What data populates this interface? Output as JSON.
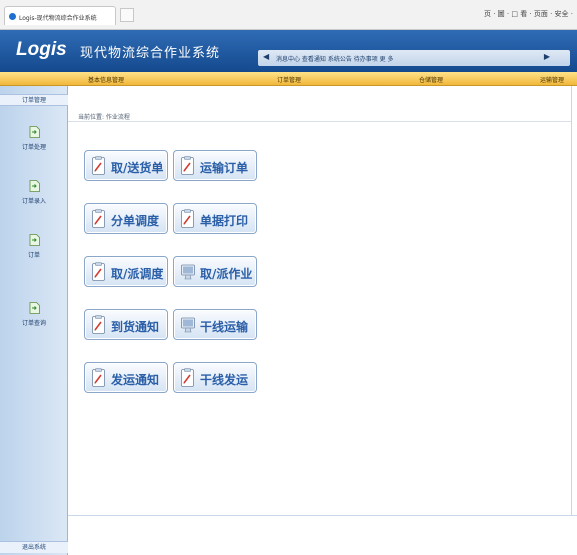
{
  "browser": {
    "tab_title": "Logis-现代物流综合作业系统",
    "toolbar_text": "页 · 圖 · □ 看 · 页面 · 安全 ·"
  },
  "header": {
    "logo": "Logis",
    "system_name": "现代物流综合作业系统",
    "ticker_text": "消息中心 查看通知 系统公告 待办事项 更 多"
  },
  "menu": {
    "items": [
      "基本信息管理",
      "订单管理",
      "仓储管理",
      "运输管理"
    ]
  },
  "sidebar": {
    "header": "订单管理",
    "items": [
      {
        "label": "订单处理",
        "icon": "document-arrow-icon"
      },
      {
        "label": "订单录入",
        "icon": "document-arrow-icon"
      },
      {
        "label": "订单",
        "icon": "document-arrow-icon"
      },
      {
        "label": "订单查询",
        "icon": "document-arrow-icon"
      }
    ],
    "footer": "退出系统"
  },
  "breadcrumb": "当前位置: 作业流程",
  "functions": [
    {
      "label": "取/送货单",
      "icon": "document-pen-icon"
    },
    {
      "label": "运输订单",
      "icon": "document-pen-icon"
    },
    {
      "label": "分单调度",
      "icon": "document-pen-icon"
    },
    {
      "label": "单据打印",
      "icon": "document-pen-icon"
    },
    {
      "label": "取/派调度",
      "icon": "document-pen-icon"
    },
    {
      "label": "取/派作业",
      "icon": "monitor-icon"
    },
    {
      "label": "到货通知",
      "icon": "document-pen-icon"
    },
    {
      "label": "干线运输",
      "icon": "monitor-icon"
    },
    {
      "label": "发运通知",
      "icon": "document-pen-icon"
    },
    {
      "label": "干线发运",
      "icon": "document-pen-icon"
    }
  ],
  "colors": {
    "banner": "#1e5aa3",
    "menubar": "#f4c552",
    "button_text": "#2a5fa8",
    "sidebar": "#cfe0f2"
  }
}
